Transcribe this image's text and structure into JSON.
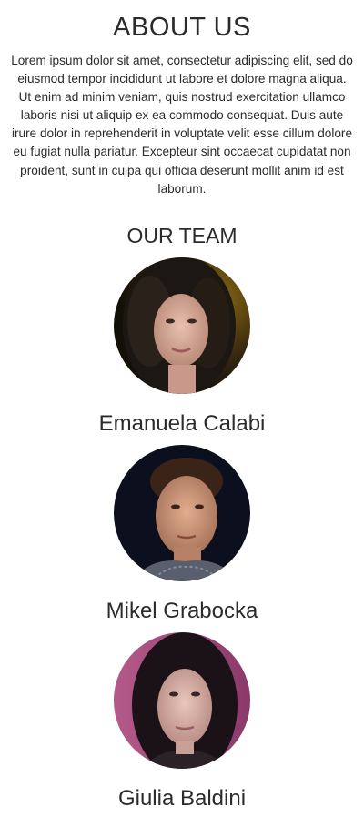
{
  "about": {
    "title": "ABOUT US",
    "text": "Lorem ipsum dolor sit amet, consectetur adipiscing elit, sed do eiusmod tempor incididunt ut labore et dolore magna aliqua. Ut enim ad minim veniam, quis nostrud exercitation ullamco laboris nisi ut aliquip ex ea commodo consequat. Duis aute irure dolor in reprehenderit in voluptate velit esse cillum dolore eu fugiat nulla pariatur. Excepteur sint occaecat cupidatat non proident, sunt in culpa qui officia deserunt mollit anim id est laborum."
  },
  "team": {
    "title": "OUR TEAM",
    "members": [
      {
        "name": "Emanuela Calabi"
      },
      {
        "name": "Mikel Grabocka"
      },
      {
        "name": "Giulia Baldini"
      }
    ]
  }
}
